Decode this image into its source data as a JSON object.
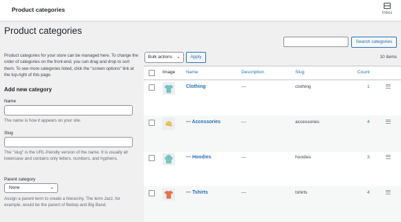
{
  "topbar": {
    "title": "Product categories",
    "inbox_label": "Inbox"
  },
  "page": {
    "heading": "Product categories"
  },
  "search": {
    "button_label": "Search categories",
    "value": ""
  },
  "intro": "Product categories for your store can be managed here. To change the order of categories on the front-end, you can drag and drop to sort them. To see more categories listed, click the \"screen options\" link at the top-right of this page.",
  "form": {
    "heading": "Add new category",
    "name_label": "Name",
    "name_value": "",
    "name_help": "The name is how it appears on your site.",
    "slug_label": "Slug",
    "slug_value": "",
    "slug_help": "The \"slug\" is the URL-friendly version of the name. It is usually all lowercase and contains only letters, numbers, and hyphens.",
    "parent_label": "Parent category",
    "parent_selected": "None",
    "parent_help": "Assign a parent term to create a hierarchy. The term Jazz, for example, would be the parent of Bebop and Big Band."
  },
  "toolbar": {
    "bulk_selected": "Bulk actions",
    "apply_label": "Apply",
    "items_count": "10 items"
  },
  "table": {
    "headers": {
      "image": "Image",
      "name": "Name",
      "description": "Description",
      "slug": "Slug",
      "count": "Count"
    },
    "rows": [
      {
        "name": "Clothing",
        "description": "—",
        "slug": "clothing",
        "count": "1",
        "icon": "tshirt-teal-icon"
      },
      {
        "name": "— Accessories",
        "description": "—",
        "slug": "accessories",
        "count": "4",
        "icon": "cap-yellow-icon"
      },
      {
        "name": "— Hoodies",
        "description": "—",
        "slug": "hoodies",
        "count": "3",
        "icon": "hoodie-teal-icon"
      },
      {
        "name": "— Tshirts",
        "description": "—",
        "slug": "tshirts",
        "count": "4",
        "icon": "tshirt-red-icon"
      }
    ]
  },
  "colors": {
    "accent": "#2271b1",
    "background": "#f0f0f1",
    "teal": "#6fc5c0",
    "yellow": "#f1c34a",
    "red": "#e5734e"
  }
}
